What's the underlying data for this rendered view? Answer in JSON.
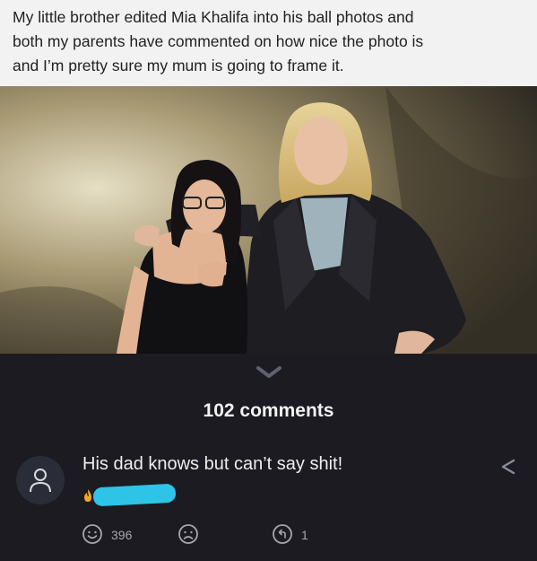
{
  "post": {
    "caption_lines": [
      "My little brother edited Mia Khalifa into his ball photos and",
      "both my parents have commented on how nice the photo is",
      "and I’m pretty sure my mum is going to frame it."
    ]
  },
  "thread": {
    "comments_label": "102 comments"
  },
  "comment": {
    "text": "His dad knows but can’t say shit!",
    "username": "",
    "happy_count": "396",
    "reply_count": "1"
  },
  "icons": {
    "collapse": "chevron-down-icon",
    "avatar": "person-icon",
    "share": "share-icon",
    "badge": "flame-icon",
    "happy": "smile-icon",
    "sad": "frown-icon",
    "reply": "reply-icon"
  },
  "colors": {
    "caption_bg": "#f2f2f2",
    "dark_bg": "#1b1b21",
    "redaction": "#2ec4e8",
    "badge": "#f2a62a"
  }
}
